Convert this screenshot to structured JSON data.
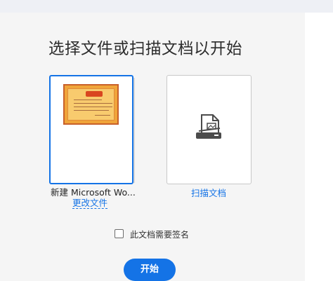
{
  "page": {
    "title": "选择文件或扫描文档以开始"
  },
  "document_card": {
    "name": "新建 Microsoft Wo...",
    "change_link": "更改文件",
    "thumbnail_heading": "奖状"
  },
  "scan_card": {
    "label": "扫描文档"
  },
  "sign_option": {
    "label": "此文档需要签名",
    "checked": false
  },
  "start_button": {
    "label": "开始"
  },
  "colors": {
    "accent": "#1473e6",
    "panel_bg": "#f5f5f5",
    "topbar_bg": "#eef0f5"
  }
}
